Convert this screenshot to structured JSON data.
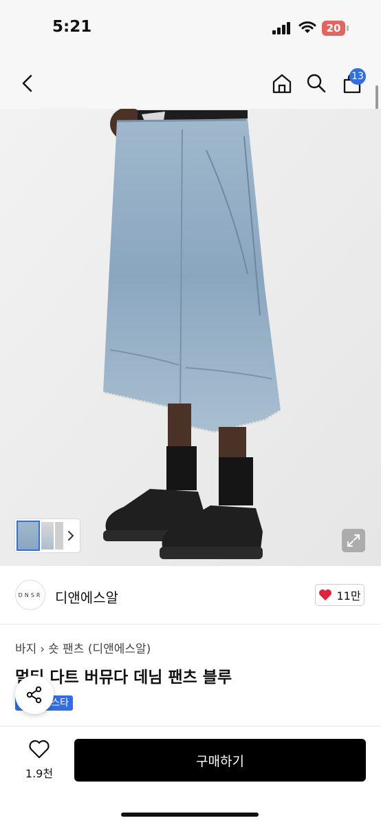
{
  "status_bar": {
    "time": "5:21",
    "battery": "20"
  },
  "nav": {
    "cart_count": "13",
    "icons": [
      "back-icon",
      "home-icon",
      "search-icon",
      "cart-icon"
    ]
  },
  "seller": {
    "logo_text": "DNSR",
    "name": "디앤에스알",
    "likes": "11만"
  },
  "product": {
    "breadcrumb": [
      "바지",
      "숏 팬츠 (디앤에스알)"
    ],
    "title": "멀티 다트 버뮤다 데님 팬츠 블루",
    "tag": "스타"
  },
  "bottom": {
    "favorite_count": "1.9천",
    "buy_label": "구매하기"
  },
  "colors": {
    "accent": "#2f6ee8",
    "heart": "#e0243b",
    "buy_button": "#000000"
  }
}
